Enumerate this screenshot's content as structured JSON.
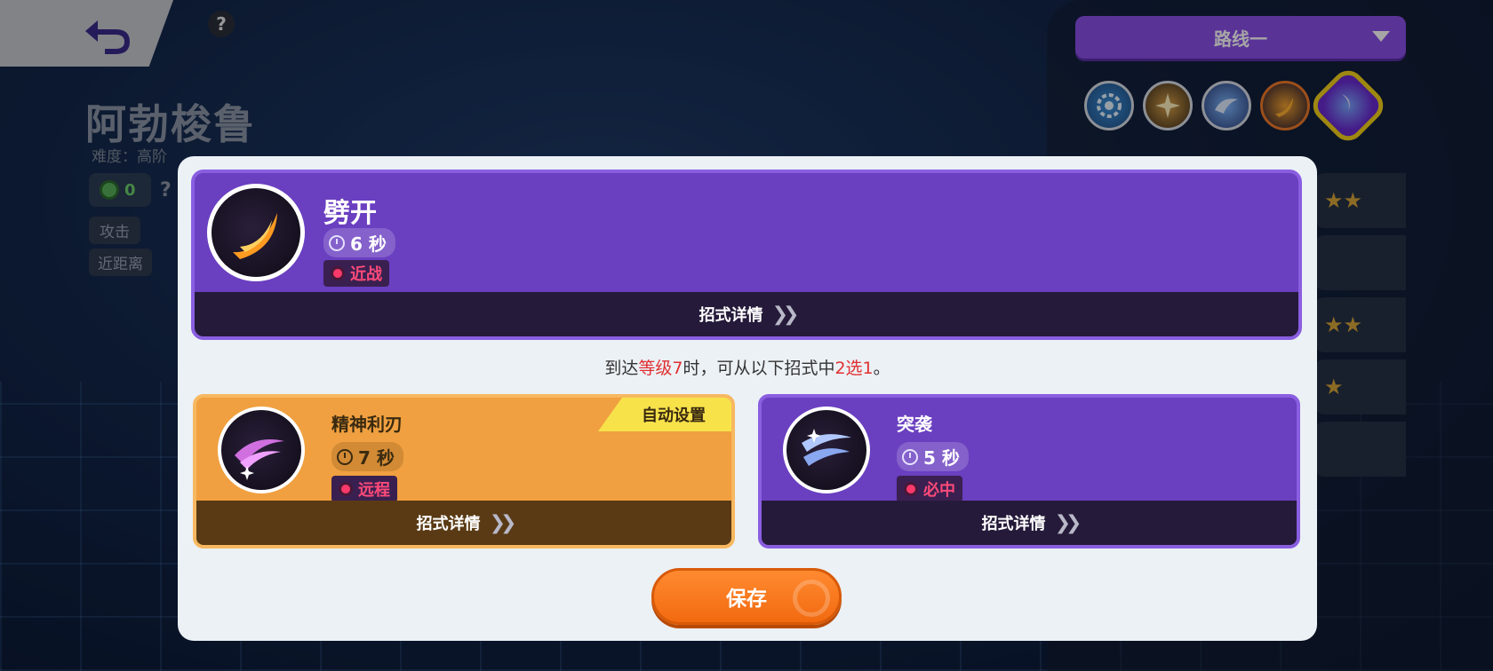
{
  "header": {
    "help_glyph": "?"
  },
  "pokemon": {
    "name": "阿勃梭鲁",
    "difficulty": "难度：高阶",
    "emblem_count": "0",
    "emblem_help": "?",
    "role_tag": "攻击",
    "range_tag": "近距离"
  },
  "route": {
    "selected": "路线一",
    "icons": [
      "gear-move-icon",
      "burst-move-icon",
      "wave-move-icon",
      "slash-move-icon",
      "unite-move-icon"
    ]
  },
  "side_rows": [
    "★★",
    "",
    "★★",
    "★",
    ""
  ],
  "main_move": {
    "name": "劈开",
    "cooldown": "6 秒",
    "type": "近战",
    "detail_label": "招式详情"
  },
  "hint": {
    "prefix": "到达",
    "level": "等级7",
    "middle": "时，可从以下招式中",
    "choice": "2选1",
    "suffix": "。"
  },
  "options": [
    {
      "name": "精神利刃",
      "cooldown": "7 秒",
      "type": "远程",
      "detail_label": "招式详情",
      "auto_tag": "自动设置"
    },
    {
      "name": "突袭",
      "cooldown": "5 秒",
      "type": "必中",
      "detail_label": "招式详情"
    }
  ],
  "save_label": "保存",
  "colors": {
    "purple_card": "#6a3fc0",
    "orange_card": "#f0a040",
    "save_button": "#f26a10",
    "route_select": "#8a4fe8"
  }
}
